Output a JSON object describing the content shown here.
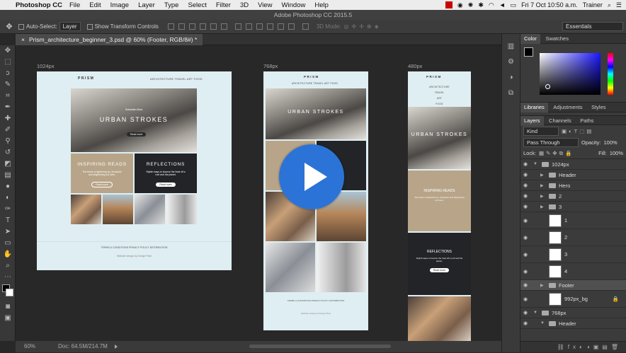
{
  "menubar": {
    "app_name": "Photoshop CC",
    "items": [
      "File",
      "Edit",
      "Image",
      "Layer",
      "Type",
      "Select",
      "Filter",
      "3D",
      "View",
      "Window",
      "Help"
    ],
    "clock": "Fri 7 Oct  10:50 a.m.",
    "user": "Trainer"
  },
  "window_title": "Adobe Photoshop CC 2015.5",
  "options": {
    "auto_select_label": "Auto-Select:",
    "auto_select_value": "Layer",
    "show_transform_label": "Show Transform Controls",
    "mode_3d_label": "3D Mode:",
    "workspace": "Essentials"
  },
  "document_tab": {
    "title": "Prism_architecture_beginner_3.psd @ 60% (Footer, RGB/8#) *",
    "close": "×"
  },
  "artboards": {
    "a1024": {
      "label": "1024px"
    },
    "a768": {
      "label": "768px"
    },
    "a480": {
      "label": "480px"
    }
  },
  "design": {
    "logo": "PRISM",
    "nav": "ARCHITECTURE   TRAVEL   ART   FOOD",
    "nav_items": [
      "ARCHITECTURE",
      "TRAVEL",
      "ART",
      "FOOD"
    ],
    "hero_small": "Sebastian Mota",
    "hero_title": "URBAN STROKES",
    "hero_btn": "Read more",
    "card1_title": "INSPIRING READS",
    "card1_text": "The future is lightening up. Sculpture and brightening our lives.",
    "card1_btn": "Read more",
    "card2_title": "REFLECTIONS",
    "card2_text": "Stylish ways to bounce the heat off a roof and the planet.",
    "card2_btn": "Read more",
    "footer_links": "TERMS & CONDITIONS   PRIVACY POLICY   DISTRIBUTION",
    "footer_credit": "Website design by Design Pixel"
  },
  "status": {
    "zoom": "60%",
    "doc": "Doc: 64.5M/214.7M"
  },
  "color_panel": {
    "tabs": [
      "Color",
      "Swatches"
    ]
  },
  "lib_panel": {
    "tabs": [
      "Libraries",
      "Adjustments",
      "Styles"
    ]
  },
  "layers_panel": {
    "tabs": [
      "Layers",
      "Channels",
      "Paths"
    ],
    "kind": "Kind",
    "blend": "Pass Through",
    "opacity_label": "Opacity:",
    "opacity": "100%",
    "lock_label": "Lock:",
    "fill_label": "Fill:",
    "fill": "100%",
    "layers": [
      {
        "name": "1024px",
        "type": "group-open",
        "indent": 0
      },
      {
        "name": "Header",
        "type": "folder",
        "indent": 1
      },
      {
        "name": "Hero",
        "type": "folder",
        "indent": 1
      },
      {
        "name": "2",
        "type": "folder",
        "indent": 1
      },
      {
        "name": "3",
        "type": "folder",
        "indent": 1
      },
      {
        "name": "1",
        "type": "smart",
        "indent": 1
      },
      {
        "name": "2",
        "type": "smart",
        "indent": 1
      },
      {
        "name": "3",
        "type": "smart",
        "indent": 1
      },
      {
        "name": "4",
        "type": "smart",
        "indent": 1
      },
      {
        "name": "Footer",
        "type": "folder",
        "indent": 1,
        "selected": true
      },
      {
        "name": "992px_bg",
        "type": "image",
        "indent": 1
      },
      {
        "name": "768px",
        "type": "group-open",
        "indent": 0
      },
      {
        "name": "Header",
        "type": "folder-open",
        "indent": 1
      }
    ]
  },
  "colors": {
    "accent_blue": "#2b73d6",
    "tan_card": "#b8a589",
    "dark_card": "#222427",
    "artboard_bg": "#dfeef2"
  }
}
